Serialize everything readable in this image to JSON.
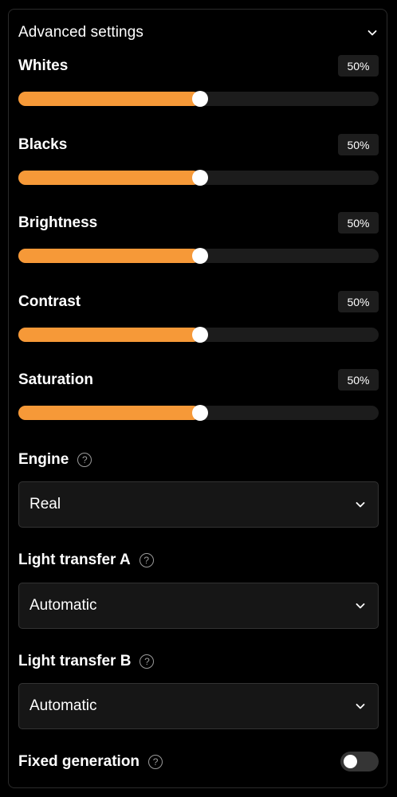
{
  "panel": {
    "title": "Advanced settings",
    "toggle_icon": "chevron-down-icon"
  },
  "sliders": [
    {
      "label": "Whites",
      "value_text": "50%",
      "value": 50
    },
    {
      "label": "Blacks",
      "value_text": "50%",
      "value": 50
    },
    {
      "label": "Brightness",
      "value_text": "50%",
      "value": 50
    },
    {
      "label": "Contrast",
      "value_text": "50%",
      "value": 50
    },
    {
      "label": "Saturation",
      "value_text": "50%",
      "value": 50
    }
  ],
  "engine": {
    "label": "Engine",
    "help_icon": "help-circle-icon",
    "selected": "Real"
  },
  "light_transfer_a": {
    "label": "Light transfer A",
    "help_icon": "help-circle-icon",
    "selected": "Automatic"
  },
  "light_transfer_b": {
    "label": "Light transfer B",
    "help_icon": "help-circle-icon",
    "selected": "Automatic"
  },
  "fixed_generation": {
    "label": "Fixed generation",
    "help_icon": "help-circle-icon",
    "enabled": false
  },
  "help_glyph": "?",
  "colors": {
    "accent": "#f69938",
    "track": "#1c1c1c",
    "background": "#000000",
    "select_background": "#161616"
  }
}
